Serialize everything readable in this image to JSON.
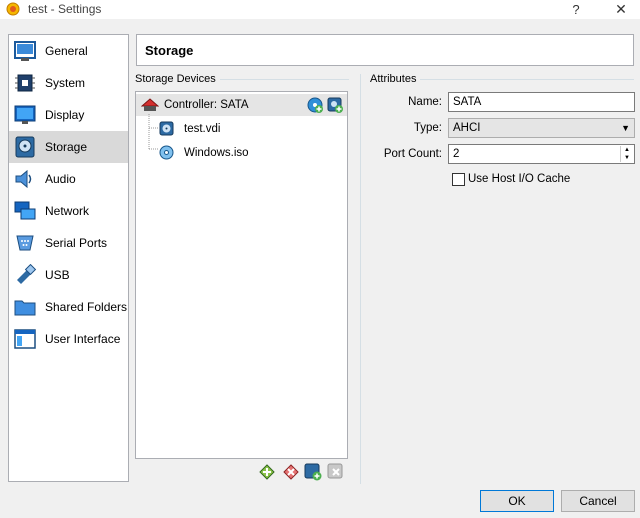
{
  "window": {
    "title": "test - Settings",
    "help_label": "?",
    "close_label": "✕"
  },
  "sidebar": {
    "items": [
      {
        "label": "General",
        "icon": "general-icon"
      },
      {
        "label": "System",
        "icon": "chip-icon"
      },
      {
        "label": "Display",
        "icon": "monitor-icon"
      },
      {
        "label": "Storage",
        "icon": "disk-icon",
        "selected": true
      },
      {
        "label": "Audio",
        "icon": "speaker-icon"
      },
      {
        "label": "Network",
        "icon": "network-icon"
      },
      {
        "label": "Serial Ports",
        "icon": "serial-port-icon"
      },
      {
        "label": "USB",
        "icon": "usb-icon"
      },
      {
        "label": "Shared Folders",
        "icon": "folder-icon"
      },
      {
        "label": "User Interface",
        "icon": "window-icon"
      }
    ]
  },
  "page": {
    "title": "Storage"
  },
  "storage_devices": {
    "section_label": "Storage Devices",
    "controller": "Controller: SATA",
    "attachments": [
      {
        "label": "test.vdi",
        "icon": "hard-disk-icon"
      },
      {
        "label": "Windows.iso",
        "icon": "optical-disc-icon"
      }
    ]
  },
  "attributes": {
    "section_label": "Attributes",
    "name_label": "Name:",
    "name_value": "SATA",
    "type_label": "Type:",
    "type_value": "AHCI",
    "port_count_label": "Port Count:",
    "port_count_value": "2",
    "host_cache_label": "Use Host I/O Cache",
    "host_cache_checked": false
  },
  "footer": {
    "ok_label": "OK",
    "cancel_label": "Cancel"
  },
  "colors": {
    "selection": "#d9d9d9",
    "default_button_border": "#0078d7",
    "add_green": "#4caf50"
  }
}
